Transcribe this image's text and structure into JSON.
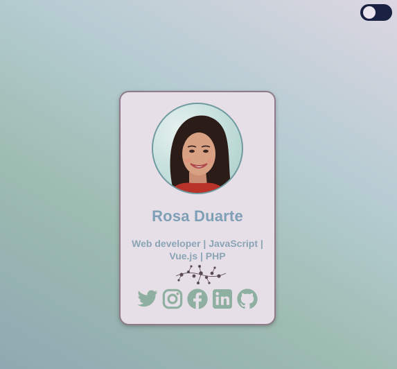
{
  "profile": {
    "name": "Rosa Duarte",
    "role": "Web developer | JavaScript | Vue.js | PHP"
  },
  "social": [
    {
      "icon": "twitter-icon"
    },
    {
      "icon": "instagram-icon"
    },
    {
      "icon": "facebook-icon"
    },
    {
      "icon": "linkedin-icon"
    },
    {
      "icon": "github-icon"
    }
  ],
  "colors": {
    "card_bg": "#e7dfe7",
    "accent": "#7e9fb5",
    "icon": "#8fb0a0",
    "toggle": "#1a2142"
  }
}
